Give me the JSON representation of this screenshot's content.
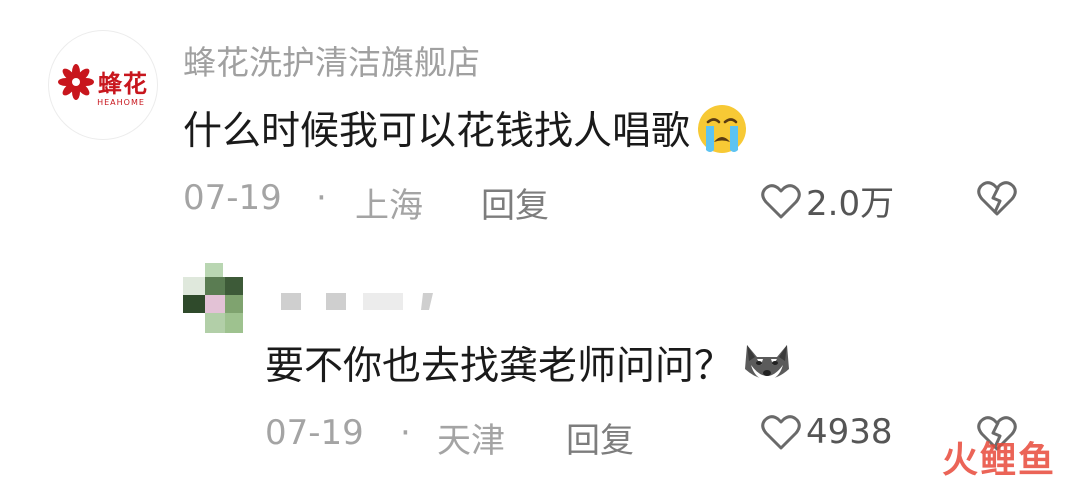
{
  "comment": {
    "username": "蜂花洗护清洁旗舰店",
    "avatar_logo_cn": "蜂花",
    "avatar_logo_en": "HEAHOME",
    "text": "什么时候我可以花钱找人唱歌",
    "date": "07-19",
    "separator": "·",
    "location": "上海",
    "reply_label": "回复",
    "likes": "2.0万",
    "emoji": "loudly-crying-face"
  },
  "reply": {
    "text": "要不你也去找龚老师问问？",
    "date": "07-19",
    "separator": "·",
    "location": "天津",
    "reply_label": "回复",
    "likes": "4938",
    "emoji": "husky-dog-face"
  },
  "watermark": "火鲤鱼",
  "colors": {
    "meta_gray": "#a4a4a4",
    "text_dark": "#1a1a1a",
    "brand_red": "#c8161d",
    "watermark_red": "#e84a3a"
  }
}
